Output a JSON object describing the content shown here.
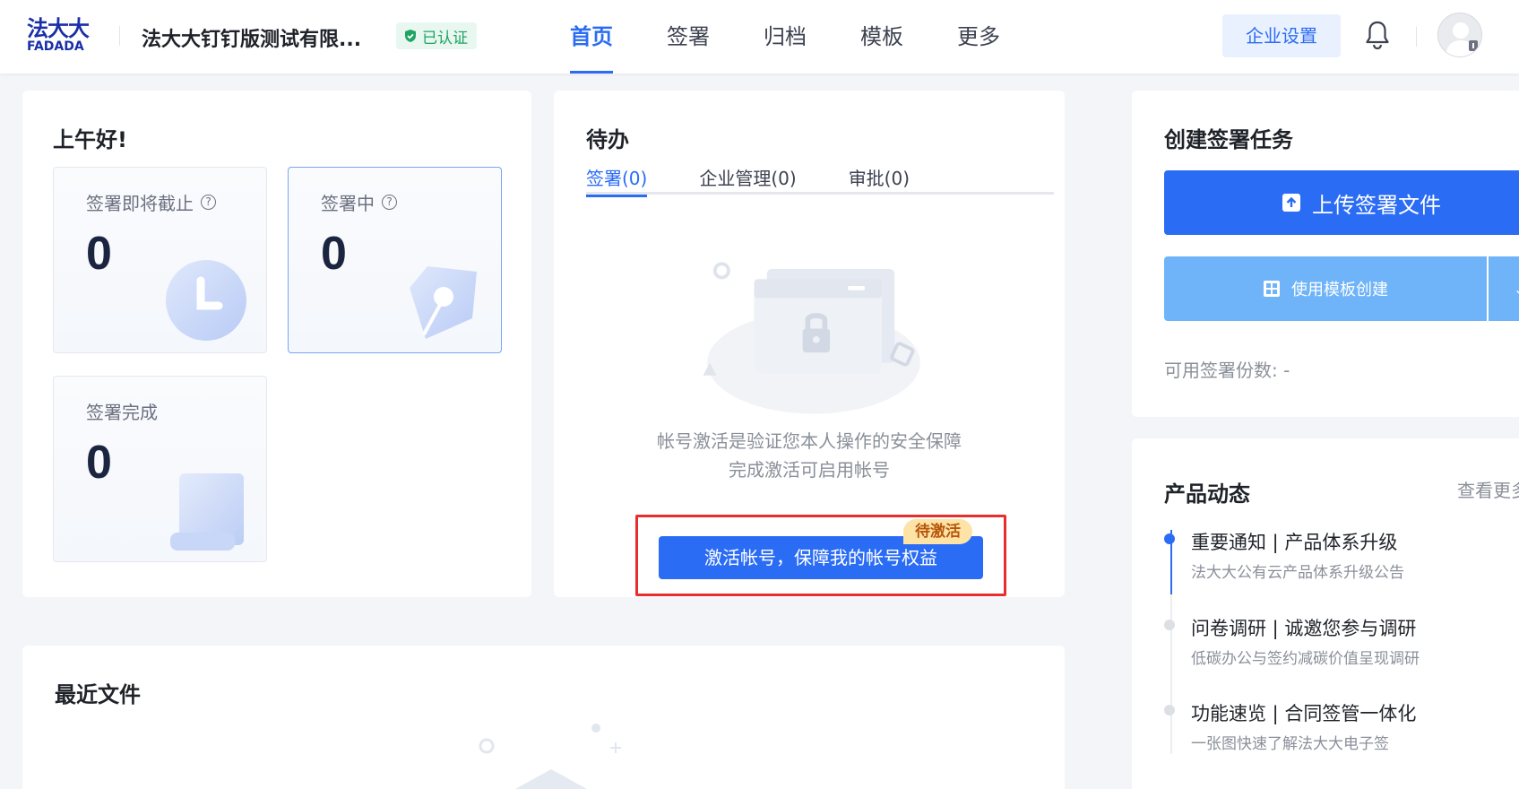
{
  "header": {
    "logo_cn": "法大大",
    "logo_en": "FADADA",
    "company": "法大大钉钉版测试有限...",
    "certified": "已认证",
    "nav": [
      {
        "label": "首页",
        "active": true
      },
      {
        "label": "签署",
        "active": false
      },
      {
        "label": "归档",
        "active": false
      },
      {
        "label": "模板",
        "active": false
      },
      {
        "label": "更多",
        "active": false
      }
    ],
    "enterprise_settings": "企业设置"
  },
  "greeting": {
    "title": "上午好!",
    "stats": [
      {
        "label": "签署即将截止",
        "value": "0"
      },
      {
        "label": "签署中",
        "value": "0"
      },
      {
        "label": "签署完成",
        "value": "0"
      }
    ]
  },
  "todo": {
    "title": "待办",
    "tabs": [
      "签署(0)",
      "企业管理(0)",
      "审批(0)"
    ],
    "empty_line1": "帐号激活是验证您本人操作的安全保障",
    "empty_line2": "完成激活可启用帐号",
    "activate_button": "激活帐号，保障我的帐号权益",
    "badge": "待激活"
  },
  "create": {
    "title": "创建签署任务",
    "upload_button": "上传签署文件",
    "template_button": "使用模板创建",
    "available": "可用签署份数:  -"
  },
  "news": {
    "title": "产品动态",
    "view_more": "查看更多",
    "items": [
      {
        "title": "重要通知 | 产品体系升级",
        "subtitle": "法大大公有云产品体系升级公告"
      },
      {
        "title": "问卷调研 | 诚邀您参与调研",
        "subtitle": "低碳办公与签约减碳价值呈现调研"
      },
      {
        "title": "功能速览 | 合同签管一体化",
        "subtitle": "一张图快速了解法大大电子签"
      }
    ]
  },
  "recent": {
    "title": "最近文件"
  },
  "colors": {
    "primary": "#2b6cf5",
    "success": "#1fa463",
    "highlight_border": "#e82d2d",
    "badge_bg": "#fde3a6"
  }
}
